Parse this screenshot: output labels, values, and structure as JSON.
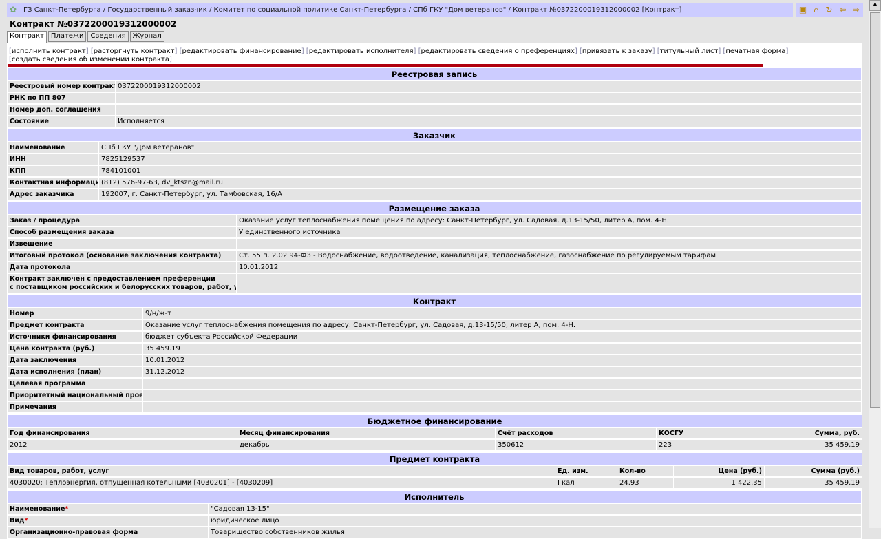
{
  "breadcrumb": "ГЗ Санкт-Петербурга / Государственный заказчик / Комитет по социальной политике Санкт-Петербурга / СПб ГКУ \"Дом ветеранов\" / Контракт №0372200019312000002 [Контракт]",
  "title": "Контракт №0372200019312000002",
  "tabs": [
    "Контракт",
    "Платежи",
    "Сведения",
    "Журнал"
  ],
  "actions": [
    "исполнить контракт",
    "расторгнуть контракт",
    "редактировать финансирование",
    "редактировать исполнителя",
    "редактировать сведения о преференциях",
    "привязать к заказу",
    "титульный лист",
    "печатная форма",
    "создать сведения об изменении контракта"
  ],
  "registry": {
    "title": "Реестровая запись",
    "rows": [
      [
        "Реестровый номер контракта",
        "0372200019312000002"
      ],
      [
        "РНК по ПП 807",
        ""
      ],
      [
        "Номер доп. соглашения",
        ""
      ],
      [
        "Состояние",
        "Исполняется"
      ]
    ]
  },
  "customer": {
    "title": "Заказчик",
    "rows": [
      [
        "Наименование",
        "СПб ГКУ \"Дом ветеранов\""
      ],
      [
        "ИНН",
        "7825129537"
      ],
      [
        "КПП",
        "784101001"
      ],
      [
        "Контактная информация",
        "(812) 576-97-63, dv_ktszn@mail.ru"
      ],
      [
        "Адрес заказчика",
        "192007, г. Санкт-Петербург, ул. Тамбовская, 16/А"
      ]
    ]
  },
  "placement": {
    "title": "Размещение заказа",
    "rows": [
      [
        "Заказ / процедура",
        "Оказание услуг теплоснабжения помещения по адресу: Санкт-Петербург, ул. Садовая, д.13-15/50, литер А, пом. 4-Н."
      ],
      [
        "Способ размещения заказа",
        "У единственного источника"
      ],
      [
        "Извещение",
        ""
      ],
      [
        "Итоговый протокол (основание заключения контракта)",
        "Ст. 55 п. 2.02 94-ФЗ - Водоснабжение, водоотведение, канализация, теплоснабжение, газоснабжение по регулируемым тарифам"
      ],
      [
        "Дата протокола",
        "10.01.2012"
      ]
    ],
    "pref_label_1": "Контракт заключен с предоставлением преференции",
    "pref_label_2": "с поставщиком российских и белорусских товаров, работ, услуг"
  },
  "contract": {
    "title": "Контракт",
    "rows": [
      [
        "Номер",
        "9/н/ж-т"
      ],
      [
        "Предмет контракта",
        "Оказание услуг теплоснабжения помещения по адресу: Санкт-Петербург, ул. Садовая, д.13-15/50, литер А, пом. 4-Н."
      ],
      [
        "Источники финансирования",
        "бюджет субъекта Российской Федерации"
      ],
      [
        "Цена контракта (руб.)",
        "35 459.19"
      ],
      [
        "Дата заключения",
        "10.01.2012"
      ],
      [
        "Дата исполнения (план)",
        "31.12.2012"
      ],
      [
        "Целевая программа",
        ""
      ],
      [
        "Приоритетный национальный проект",
        ""
      ],
      [
        "Примечания",
        ""
      ]
    ]
  },
  "budget": {
    "title": "Бюджетное финансирование",
    "headers": [
      "Год финансирования",
      "Месяц финансирования",
      "Счёт расходов",
      "КОСГУ",
      "Сумма, руб."
    ],
    "row": [
      "2012",
      "декабрь",
      "350612",
      "223",
      "35 459.19"
    ]
  },
  "subject": {
    "title": "Предмет контракта",
    "headers": [
      "Вид товаров, работ, услуг",
      "Ед. изм.",
      "Кол-во",
      "Цена (руб.)",
      "Сумма (руб.)"
    ],
    "row": [
      "4030020: Теплоэнергия, отпущенная котельными [4030201] - [4030209]",
      "Гкал",
      "24.93",
      "1 422.35",
      "35 459.19"
    ]
  },
  "supplier": {
    "title": "Исполнитель",
    "rows": [
      [
        "Наименование",
        "\"Садовая 13-15\""
      ],
      [
        "Вид",
        "юридическое лицо"
      ],
      [
        "Организационно-правовая форма",
        "Товарищество собственников жилья"
      ]
    ]
  }
}
